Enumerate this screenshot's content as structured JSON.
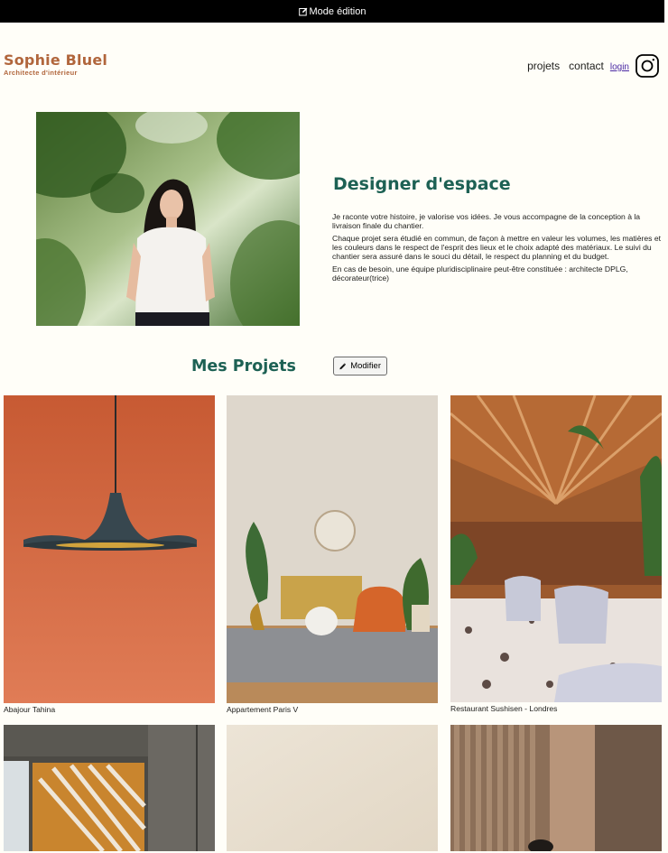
{
  "edit_bar": {
    "icon": "edit-icon",
    "label": "Mode édition"
  },
  "header": {
    "logo_title": "Sophie Bluel",
    "logo_subtitle": "Architecte d'intérieur",
    "nav": {
      "projects": "projets",
      "contact": "contact",
      "login": "login",
      "instagram_icon": "instagram-icon"
    }
  },
  "intro": {
    "title": "Designer d'espace",
    "paragraphs": [
      "Je raconte votre histoire, je valorise vos idées. Je vous accompagne de la conception à la livraison finale du chantier.",
      "Chaque projet sera étudié en commun, de façon à mettre en valeur les volumes, les matières et les couleurs dans le respect de l'esprit des lieux et le choix adapté des matériaux. Le suivi du chantier sera assuré dans le souci du détail, le respect du planning et du budget.",
      "En cas de besoin, une équipe pluridisciplinaire peut-être constituée : architecte DPLG, décorateur(trice)"
    ]
  },
  "projects": {
    "title": "Mes Projets",
    "modify_label": "Modifier",
    "modify_icon": "pencil-icon",
    "items": [
      {
        "caption": "Abajour Tahina"
      },
      {
        "caption": "Appartement Paris V"
      },
      {
        "caption": "Restaurant Sushisen - Londres"
      },
      {
        "caption": ""
      },
      {
        "caption": ""
      },
      {
        "caption": ""
      }
    ]
  },
  "colors": {
    "accent": "#1D6154",
    "brand": "#B1663C",
    "background": "#FFFEF8",
    "edit_bar": "#000000"
  }
}
